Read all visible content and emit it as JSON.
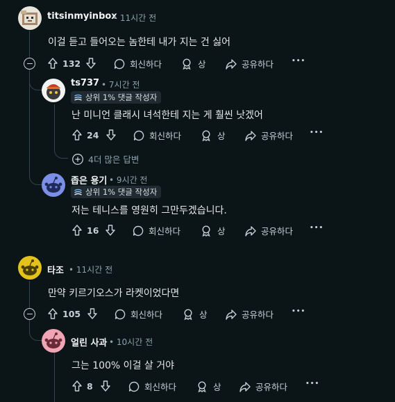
{
  "comments": [
    {
      "user": "titsinmyinbox",
      "time": "11시간 전",
      "body": "이걸 듣고 들어오는 놈한테 내가 지는 건 싫어",
      "votes": "132",
      "reply": "회신하다",
      "award": "상",
      "share": "공유하다"
    },
    {
      "user": "ts737",
      "time": "7시간 전",
      "badge": "상위 1% 댓글 작성자",
      "body": "난 미니언 클래시 녀석한테 지는 게 훨씬 낫겠어",
      "votes": "24",
      "reply": "회신하다",
      "award": "상",
      "share": "공유하다",
      "more_replies": "4더 많은 답변"
    },
    {
      "user": "좁은 용기",
      "time": "9시간 전",
      "badge": "상위 1% 댓글 작성자",
      "body": "저는 테니스를 영원히 그만두겠습니다.",
      "votes": "16",
      "reply": "회신하다",
      "award": "상",
      "share": "공유하다"
    },
    {
      "user": "타조",
      "time": "11시간 전",
      "body": "만약 키르기오스가 라켓이었다면",
      "votes": "105",
      "reply": "회신하다",
      "award": "상",
      "share": "공유하다"
    },
    {
      "user": "얼린 사과",
      "time": "10시간 전",
      "body": "그는 100% 이걸 살 거야",
      "votes": "8",
      "reply": "회신하다",
      "award": "상",
      "share": "공유하다"
    }
  ],
  "meta_separator": "•",
  "more_glyph": "•••",
  "colors": {
    "background": "#0b1416",
    "thread_line": "#33464c",
    "text": "#e3e8ea",
    "meta": "#8ba2ad"
  }
}
